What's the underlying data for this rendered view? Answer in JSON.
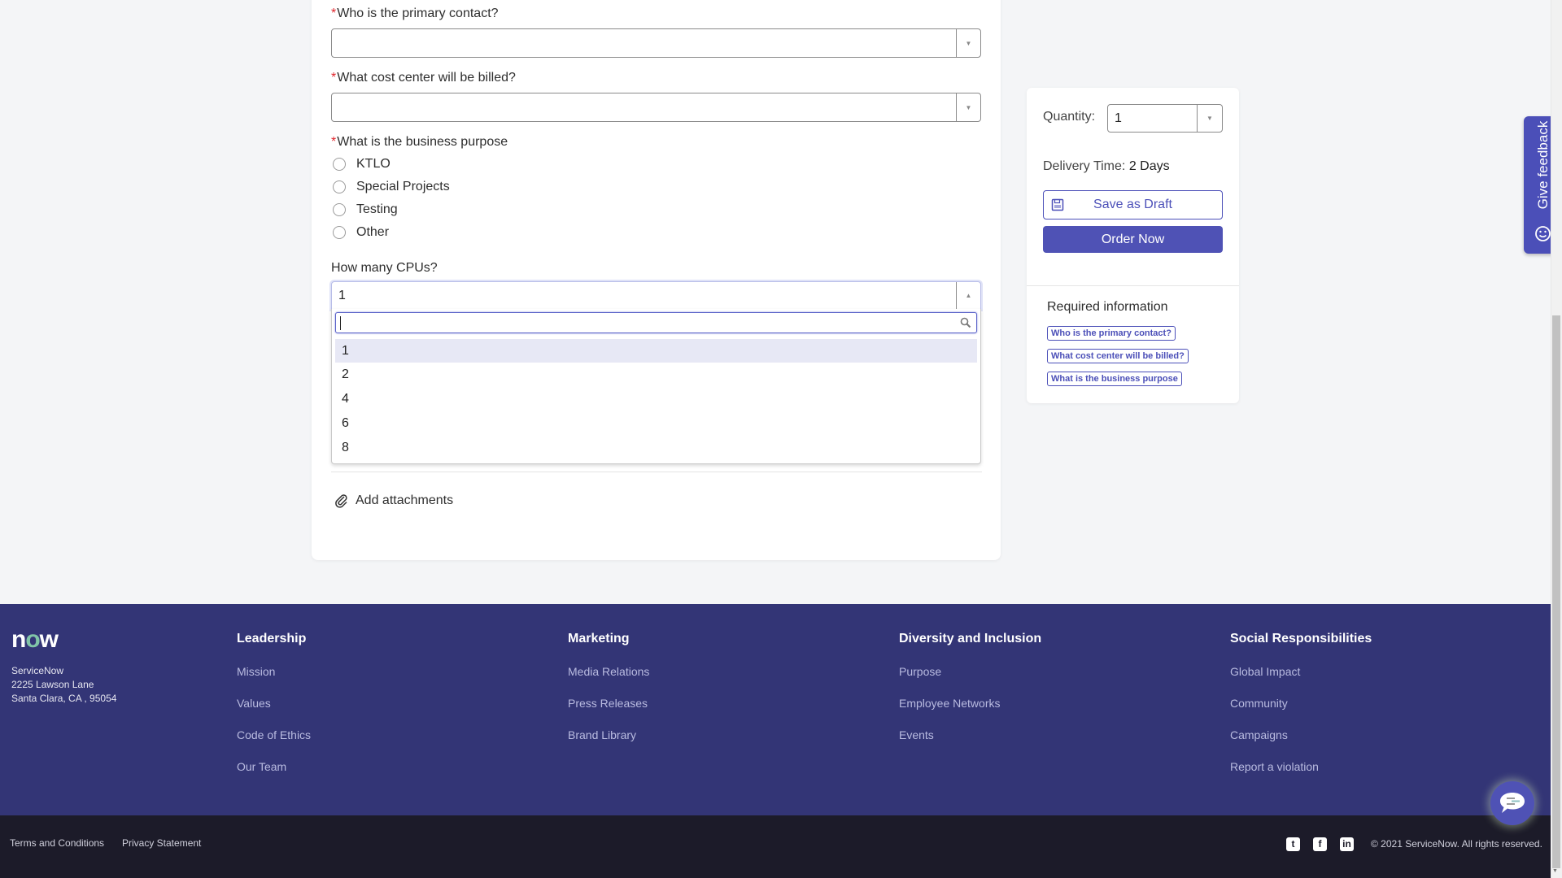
{
  "form": {
    "fields": [
      {
        "label": "Who is the primary contact?",
        "required": true,
        "value": ""
      },
      {
        "label": "What cost center will be billed?",
        "required": true,
        "value": ""
      }
    ],
    "business_purpose": {
      "label": "What is the business purpose",
      "required": true,
      "options": [
        "KTLO",
        "Special Projects",
        "Testing",
        "Other"
      ]
    },
    "cpus": {
      "label": "How many CPUs?",
      "value": "1",
      "search_value": "",
      "options": [
        "1",
        "2",
        "4",
        "6",
        "8"
      ],
      "highlighted": "1"
    },
    "attachments_label": "Add attachments",
    "required_marker": "*"
  },
  "order_panel": {
    "quantity_label": "Quantity:",
    "quantity_value": "1",
    "delivery_label": "Delivery Time:",
    "delivery_value": "2 Days",
    "save_draft_label": "Save as Draft",
    "order_now_label": "Order Now",
    "required_title": "Required information",
    "required_items": [
      "Who is the primary contact?",
      "What cost center will be billed?",
      "What is the business purpose"
    ]
  },
  "feedback_tab": {
    "label": "Give feedback",
    "icon": "smile-icon"
  },
  "footer": {
    "logo": {
      "pre": "n",
      "o": "o",
      "post": "w"
    },
    "address": [
      "ServiceNow",
      "2225 Lawson Lane",
      "Santa Clara, CA , 95054"
    ],
    "columns": [
      {
        "heading": "Leadership",
        "links": [
          "Mission",
          "Values",
          "Code of Ethics",
          "Our Team"
        ]
      },
      {
        "heading": "Marketing",
        "links": [
          "Media Relations",
          "Press Releases",
          "Brand Library"
        ]
      },
      {
        "heading": "Diversity and Inclusion",
        "links": [
          "Purpose",
          "Employee Networks",
          "Events"
        ]
      },
      {
        "heading": "Social Responsibilities",
        "links": [
          "Global Impact",
          "Community",
          "Campaigns",
          "Report a violation"
        ]
      }
    ],
    "bottom_links": [
      "Terms and Conditions",
      "Privacy Statement"
    ],
    "social": [
      {
        "name": "twitter-icon",
        "glyph": "t"
      },
      {
        "name": "facebook-icon",
        "glyph": "f"
      },
      {
        "name": "linkedin-icon",
        "glyph": "in"
      }
    ],
    "copyright": "© 2021 ServiceNow. All rights reserved."
  },
  "colors": {
    "accent": "#4f52b5",
    "footer_bg": "#333576",
    "bottom_bar_bg": "#1c1b29",
    "required": "#e0262d"
  }
}
